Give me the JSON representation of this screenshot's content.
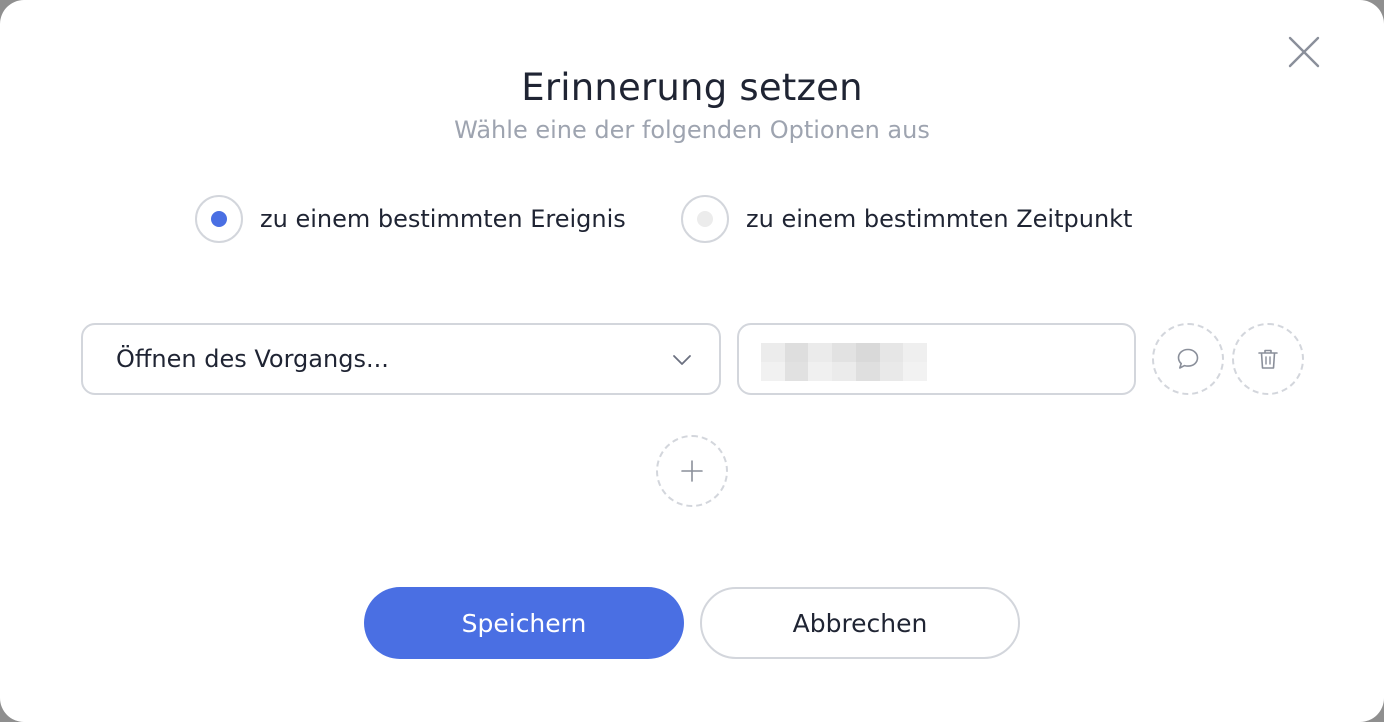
{
  "dialog": {
    "title": "Erinnerung setzen",
    "subtitle": "Wähle eine der folgenden Optionen aus",
    "close_icon": "close-icon"
  },
  "options": [
    {
      "label": "zu einem bestimmten Ereignis",
      "selected": true
    },
    {
      "label": "zu einem bestimmten Zeitpunkt",
      "selected": false
    }
  ],
  "reminder_row": {
    "event_select": {
      "value": "Öffnen des Vorgangs...",
      "icon": "chevron-down-icon"
    },
    "value_field": {
      "value": "",
      "redacted": true
    },
    "comment_icon": "comment-icon",
    "delete_icon": "trash-icon"
  },
  "add_icon": "plus-icon",
  "actions": {
    "save_label": "Speichern",
    "cancel_label": "Abbrechen"
  },
  "colors": {
    "accent": "#4a6fe3",
    "text": "#1f2433",
    "muted": "#9ea4b0",
    "border": "#d3d6dc"
  }
}
